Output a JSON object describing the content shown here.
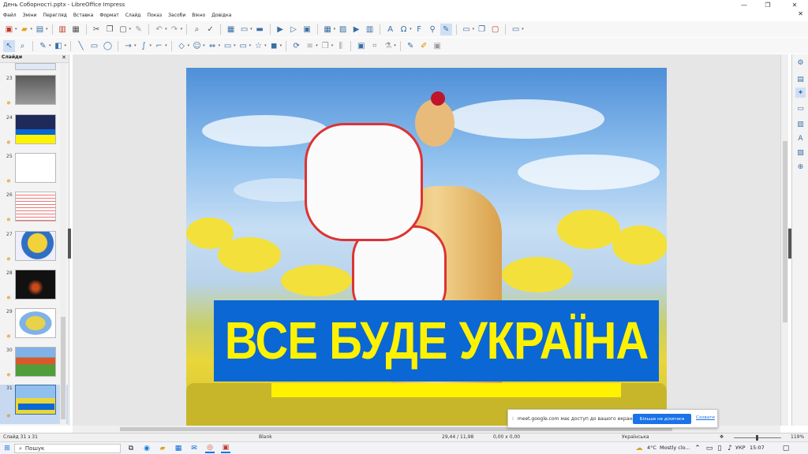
{
  "window": {
    "title": "День Соборності.pptx - LibreOffice Impress",
    "minimize_icon": "—",
    "maximize_icon": "❐",
    "close_icon": "✕"
  },
  "menubar": {
    "items": [
      "Файл",
      "Зміни",
      "Перегляд",
      "Вставка",
      "Формат",
      "Слайд",
      "Показ",
      "Засоби",
      "Вікно",
      "Довідка"
    ],
    "close_icon": "✕"
  },
  "sidebar": {
    "title": "Слайди",
    "close_icon": "✕",
    "thumbnails": [
      {
        "number": "23",
        "selected": false
      },
      {
        "number": "24",
        "selected": false
      },
      {
        "number": "25",
        "selected": false
      },
      {
        "number": "26",
        "selected": false
      },
      {
        "number": "27",
        "selected": false
      },
      {
        "number": "28",
        "selected": false
      },
      {
        "number": "29",
        "selected": false
      },
      {
        "number": "30",
        "selected": false
      },
      {
        "number": "31",
        "selected": true
      }
    ]
  },
  "slide": {
    "headline": "ВСЕ БУДЕ УКРАЇНА",
    "banner_color": "#0b67d3",
    "text_color": "#fff200",
    "bar_color": "#fff200"
  },
  "statusbar": {
    "slide_info": "Слайд 31 з 31",
    "layout": "Blank",
    "position": "29,44 / 11,98",
    "size": "0,00 x 0,00",
    "language": "Українська",
    "zoom": "119%"
  },
  "notification": {
    "message": "meet.google.com має доступ до вашого екрана.",
    "stop_button": "Більше не ділитися",
    "hide_link": "Сховати"
  },
  "taskbar": {
    "search_placeholder": "Пошук",
    "weather_temp": "4°C",
    "weather_text": "Mostly clo...",
    "language": "УКР",
    "time": "15:07"
  }
}
